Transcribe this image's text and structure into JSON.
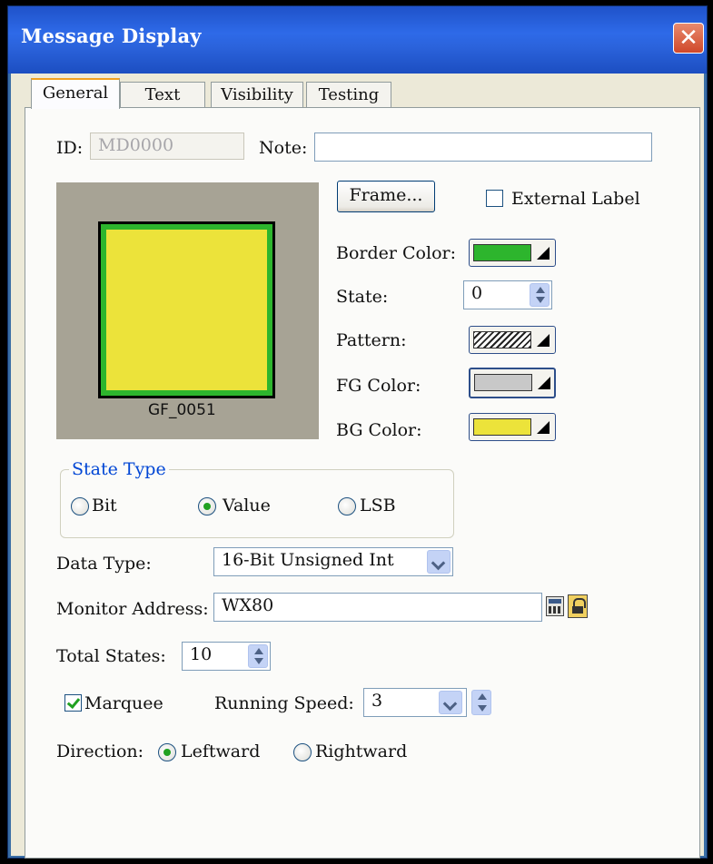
{
  "window": {
    "title": "Message Display",
    "close_label": "✕"
  },
  "tabs": [
    {
      "label": "General",
      "active": true
    },
    {
      "label": "Text",
      "active": false
    },
    {
      "label": "Visibility",
      "active": false
    },
    {
      "label": "Testing",
      "active": false
    }
  ],
  "general": {
    "id_label": "ID:",
    "id_value": "MD0000",
    "note_label": "Note:",
    "note_value": "",
    "frame_button": "Frame...",
    "external_label": "External Label",
    "external_label_checked": false,
    "preview_caption": "GF_0051",
    "border_color_label": "Border Color:",
    "state_label": "State:",
    "state_value": "0",
    "pattern_label": "Pattern:",
    "fg_color_label": "FG Color:",
    "bg_color_label": "BG Color:",
    "state_type": {
      "title": "State Type",
      "options": [
        "Bit",
        "Value",
        "LSB"
      ],
      "selected": "Value"
    },
    "data_type_label": "Data Type:",
    "data_type_value": "16-Bit Unsigned Int",
    "monitor_address_label": "Monitor Address:",
    "monitor_address_value": "WX80",
    "total_states_label": "Total States:",
    "total_states_value": "10",
    "marquee_label": "Marquee",
    "marquee_checked": true,
    "running_speed_label": "Running Speed:",
    "running_speed_value": "3",
    "direction_label": "Direction:",
    "direction_options": [
      "Leftward",
      "Rightward"
    ],
    "direction_selected": "Leftward"
  },
  "colors": {
    "border_color": "#2db52d",
    "fg_color": "#c8c8c8",
    "bg_color": "#ece33a"
  }
}
